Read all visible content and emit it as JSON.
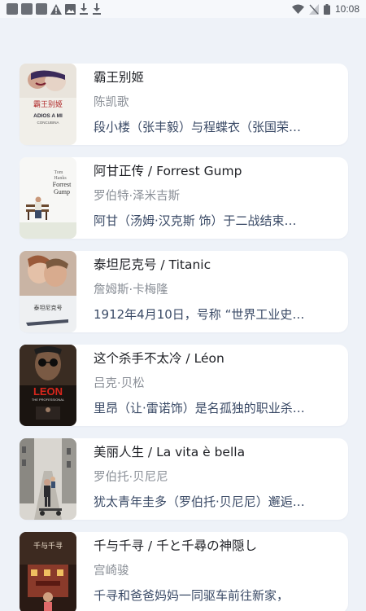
{
  "status_bar": {
    "time": "10:08",
    "left_icons": [
      "notification-icon",
      "notification-icon",
      "notification-icon",
      "warning-icon",
      "image-icon",
      "download-icon",
      "download-icon"
    ],
    "right_icons": [
      "wifi-icon",
      "no-signal-icon",
      "battery-icon"
    ]
  },
  "movies": [
    {
      "title": "霸王别姬",
      "director": "陈凯歌",
      "summary": "段小楼（张丰毅）与程蝶衣（张国荣…",
      "poster_icon": "farewell-my-concubine-poster"
    },
    {
      "title": "阿甘正传 / Forrest Gump",
      "director": "罗伯特·泽米吉斯",
      "summary": "阿甘（汤姆·汉克斯 饰）于二战结束…",
      "poster_icon": "forrest-gump-poster"
    },
    {
      "title": "泰坦尼克号 / Titanic",
      "director": "詹姆斯·卡梅隆",
      "summary": "1912年4月10日，号称 “世界工业史…",
      "poster_icon": "titanic-poster"
    },
    {
      "title": "这个杀手不太冷 / Léon",
      "director": "吕克·贝松",
      "summary": "里昂（让·雷诺饰）是名孤独的职业杀…",
      "poster_icon": "leon-poster"
    },
    {
      "title": "美丽人生 / La vita è bella",
      "director": "罗伯托·贝尼尼",
      "summary": "犹太青年圭多（罗伯托·贝尼尼）邂逅…",
      "poster_icon": "life-is-beautiful-poster"
    },
    {
      "title": "千与千寻 / 千と千尋の神隠し",
      "director": "宫崎骏",
      "summary": "千寻和爸爸妈妈一同驱车前往新家，",
      "poster_icon": "spirited-away-poster"
    }
  ],
  "poster_text": {
    "m0_line1": "霸王别姬",
    "m0_line2": "ADIOS A MI",
    "m0_line3": "CONCUBINA",
    "m1_line1": "Tom",
    "m1_line2": "Hanks",
    "m1_line3": "Forrest",
    "m1_line4": "Gump",
    "m2_line1": "泰坦尼克号",
    "m3_line1": "LEON",
    "m3_line2": "THE PROFESSIONAL",
    "m5_line1": "千与千寻"
  }
}
